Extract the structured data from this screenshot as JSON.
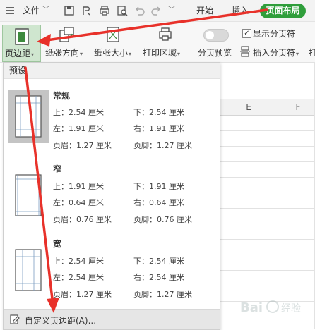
{
  "topbar": {
    "file_label": "文件",
    "tabs": {
      "start": "开始",
      "insert": "插入",
      "page_layout": "页面布局"
    }
  },
  "ribbon": {
    "margins": "页边距",
    "orientation": "纸张方向",
    "size": "纸张大小",
    "print_area": "打印区域",
    "page_break_preview": "分页预览",
    "show_page_break": "显示分页符",
    "insert_page_break": "插入分页符",
    "print_partial": "打"
  },
  "sheet": {
    "columns": [
      "E",
      "F"
    ]
  },
  "dropdown": {
    "header": "预设",
    "presets": [
      {
        "name": "常规",
        "top": "上：2.54 厘米",
        "bottom": "下：2.54 厘米",
        "left": "左：1.91 厘米",
        "right": "右：1.91 厘米",
        "header": "页眉：1.27 厘米",
        "footer": "页脚：1.27 厘米"
      },
      {
        "name": "窄",
        "top": "上：1.91 厘米",
        "bottom": "下：1.91 厘米",
        "left": "左：0.64 厘米",
        "right": "右：0.64 厘米",
        "header": "页眉：0.76 厘米",
        "footer": "页脚：0.76 厘米"
      },
      {
        "name": "宽",
        "top": "上：2.54 厘米",
        "bottom": "下：2.54 厘米",
        "left": "左：2.54 厘米",
        "right": "右：2.54 厘米",
        "header": "页眉：1.27 厘米",
        "footer": "页脚：1.27 厘米"
      }
    ],
    "custom": "自定义页边距(A)..."
  },
  "colors": {
    "accent": "#2f9e3b",
    "arrow": "#e8312a",
    "selected_bg": "#cfe6cf"
  },
  "watermark": "Bai 经验"
}
